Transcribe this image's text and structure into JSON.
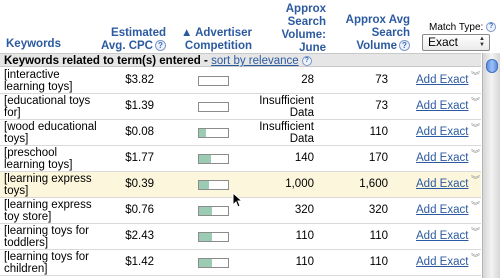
{
  "header": {
    "keywords": "Keywords",
    "cpc_line1": "Estimated",
    "cpc_line2": "Avg. CPC",
    "competition_line1": "▲ Advertiser",
    "competition_line2": "Competition",
    "search_line1": "Approx",
    "search_line2": "Search",
    "search_line3": "Volume: June",
    "avg_line1": "Approx Avg",
    "avg_line2": "Search",
    "avg_line3": "Volume",
    "match_type_label": "Match Type:",
    "match_type_value": "Exact",
    "help_glyph": "?"
  },
  "section": {
    "title": "Keywords related to term(s) entered",
    "separator": " - ",
    "sort_link": "sort by relevance"
  },
  "rows": [
    {
      "kw1": "[interactive",
      "kw2": "learning toys]",
      "cpc": "$3.82",
      "competition": 0.0,
      "vol1": "28",
      "vol2": "",
      "avg": "73",
      "action": "Add Exact"
    },
    {
      "kw1": "[educational toys",
      "kw2": "for]",
      "cpc": "$1.39",
      "competition": 0.0,
      "vol1": "Insufficient",
      "vol2": "Data",
      "avg": "73",
      "action": "Add Exact"
    },
    {
      "kw1": "[wood educational",
      "kw2": "toys]",
      "cpc": "$0.08",
      "competition": 0.25,
      "vol1": "Insufficient",
      "vol2": "Data",
      "avg": "110",
      "action": "Add Exact"
    },
    {
      "kw1": "[preschool",
      "kw2": "learning toys]",
      "cpc": "$1.77",
      "competition": 0.4,
      "vol1": "140",
      "vol2": "",
      "avg": "170",
      "action": "Add Exact"
    },
    {
      "kw1": "[learning express",
      "kw2": "toys]",
      "cpc": "$0.39",
      "competition": 0.35,
      "vol1": "1,000",
      "vol2": "",
      "avg": "1,600",
      "action": "Add Exact"
    },
    {
      "kw1": "[learning express",
      "kw2": "toy store]",
      "cpc": "$0.76",
      "competition": 0.45,
      "vol1": "320",
      "vol2": "",
      "avg": "320",
      "action": "Add Exact"
    },
    {
      "kw1": "[learning toys for",
      "kw2": "toddlers]",
      "cpc": "$2.43",
      "competition": 0.45,
      "vol1": "110",
      "vol2": "",
      "avg": "110",
      "action": "Add Exact"
    },
    {
      "kw1": "[learning toys for",
      "kw2": "children]",
      "cpc": "$1.42",
      "competition": 0.45,
      "vol1": "110",
      "vol2": "",
      "avg": "110",
      "action": "Add Exact"
    }
  ],
  "colors": {
    "header_text": "#2c5aa0",
    "competition_fill": "#9ccbb4",
    "highlight_row": "#fbf6dc",
    "section_bg": "#e6e6e6"
  },
  "icons": {
    "help": "help-icon",
    "row_menu": "chevron-down-icon",
    "scroll": "scroll-thumb",
    "cursor": "mouse-pointer-icon"
  }
}
